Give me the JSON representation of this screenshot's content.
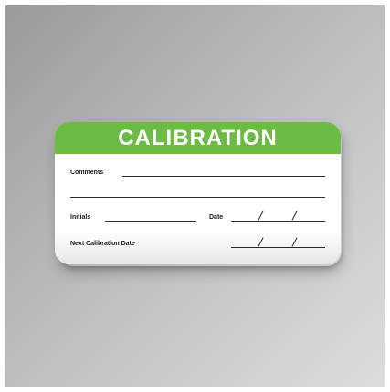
{
  "label": {
    "title": "CALIBRATION",
    "header_color": "#6cbb45",
    "fields": {
      "comments": "Comments",
      "initials": "Initials",
      "date": "Date",
      "next_calibration_date": "Next Calibration Date"
    }
  }
}
